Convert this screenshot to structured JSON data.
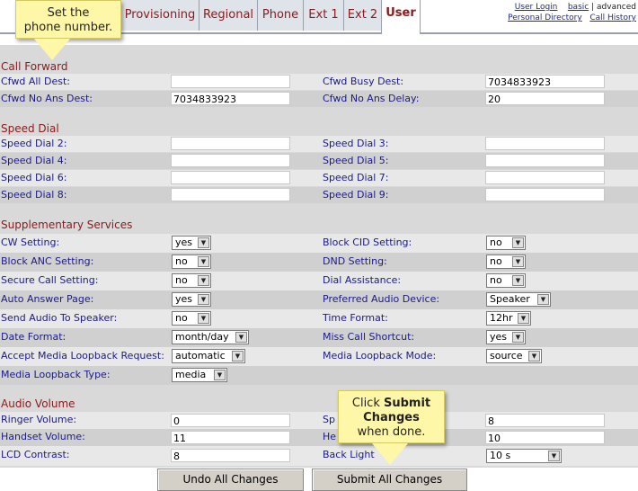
{
  "tabs": [
    {
      "label": "Provisioning"
    },
    {
      "label": "Regional"
    },
    {
      "label": "Phone"
    },
    {
      "label": "Ext 1"
    },
    {
      "label": "Ext 2"
    },
    {
      "label": "User"
    }
  ],
  "top_links": {
    "user_login": "User Login",
    "basic": "basic",
    "separator": "|",
    "advanced": "advanced",
    "personal_directory": "Personal Directory",
    "call_history": "Call History"
  },
  "call_forward": {
    "heading": "Call Forward",
    "cfwd_all_dest": {
      "label": "Cfwd All Dest:",
      "value": ""
    },
    "cfwd_busy_dest": {
      "label": "Cfwd Busy Dest:",
      "value": "7034833923"
    },
    "cfwd_no_ans_dest": {
      "label": "Cfwd No Ans Dest:",
      "value": "7034833923"
    },
    "cfwd_no_ans_delay": {
      "label": "Cfwd No Ans Delay:",
      "value": "20"
    }
  },
  "speed_dial": {
    "heading": "Speed Dial",
    "items": [
      {
        "label": "Speed Dial 2:",
        "value": ""
      },
      {
        "label": "Speed Dial 3:",
        "value": ""
      },
      {
        "label": "Speed Dial 4:",
        "value": ""
      },
      {
        "label": "Speed Dial 5:",
        "value": ""
      },
      {
        "label": "Speed Dial 6:",
        "value": ""
      },
      {
        "label": "Speed Dial 7:",
        "value": ""
      },
      {
        "label": "Speed Dial 8:",
        "value": ""
      },
      {
        "label": "Speed Dial 9:",
        "value": ""
      }
    ]
  },
  "supplementary": {
    "heading": "Supplementary Services",
    "items": [
      {
        "label": "CW Setting:",
        "value": "yes"
      },
      {
        "label": "Block CID Setting:",
        "value": "no"
      },
      {
        "label": "Block ANC Setting:",
        "value": "no"
      },
      {
        "label": "DND Setting:",
        "value": "no"
      },
      {
        "label": "Secure Call Setting:",
        "value": "no"
      },
      {
        "label": "Dial Assistance:",
        "value": "no"
      },
      {
        "label": "Auto Answer Page:",
        "value": "yes"
      },
      {
        "label": "Preferred Audio Device:",
        "value": "Speaker"
      },
      {
        "label": "Send Audio To Speaker:",
        "value": "no"
      },
      {
        "label": "Time Format:",
        "value": "12hr"
      },
      {
        "label": "Date Format:",
        "value": "month/day"
      },
      {
        "label": "Miss Call Shortcut:",
        "value": "yes"
      },
      {
        "label": "Accept Media Loopback Request:",
        "value": "automatic"
      },
      {
        "label": "Media Loopback Mode:",
        "value": "source"
      },
      {
        "label": "Media Loopback Type:",
        "value": "media"
      }
    ]
  },
  "audio_volume": {
    "heading": "Audio Volume",
    "ringer_volume": {
      "label": "Ringer Volume:",
      "value": "0"
    },
    "speaker_volume": {
      "label": "Sp",
      "value": "8"
    },
    "handset_volume": {
      "label": "Handset Volume:",
      "value": "11"
    },
    "headset_volume": {
      "label": "He",
      "value": "10"
    },
    "lcd_contrast": {
      "label": "LCD Contrast:",
      "value": "8"
    },
    "back_light": {
      "label": "Back Light",
      "value": "10 s"
    }
  },
  "buttons": {
    "undo": "Undo All Changes",
    "submit": "Submit All Changes"
  },
  "callouts": {
    "top_line1": "Set the",
    "top_line2": "phone number.",
    "bottom_line1_pre": "Click ",
    "bottom_line1_bold": "Submit",
    "bottom_line2": "Changes",
    "bottom_line3": "when done."
  },
  "colors": {
    "label_blue": "#1a1a8a",
    "heading_red": "#8b1a1a",
    "callout_yellow": "#fff7a8"
  }
}
